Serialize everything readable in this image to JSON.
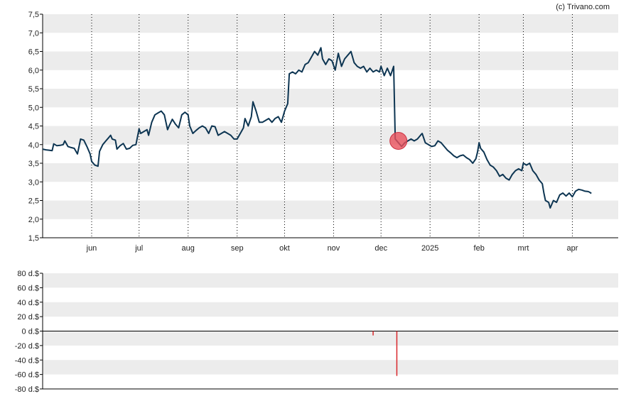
{
  "copyright": "(c) Trivano.com",
  "colors": {
    "line": "#0d3552",
    "band": "#ececec",
    "grid": "#000000",
    "marker": "#e8505b",
    "bar": "#d9262a"
  },
  "chart_data": [
    {
      "type": "line",
      "ylim": [
        1.5,
        7.5
      ],
      "yticks": [
        "7,5",
        "7,0",
        "6,5",
        "6,0",
        "5,5",
        "5,0",
        "4,5",
        "4,0",
        "3,5",
        "3,0",
        "2,5",
        "2,0",
        "1,5"
      ],
      "ytick_values": [
        7.5,
        7.0,
        6.5,
        6.0,
        5.5,
        5.0,
        4.5,
        4.0,
        3.5,
        3.0,
        2.5,
        2.0,
        1.5
      ],
      "xticks": [
        "jun",
        "jul",
        "aug",
        "sep",
        "okt",
        "nov",
        "dec",
        "2025",
        "feb",
        "mrt",
        "apr"
      ],
      "xtick_days": [
        31,
        61,
        92,
        123,
        153,
        184,
        214,
        245,
        276,
        304,
        335
      ],
      "xlim_days": [
        0,
        364
      ],
      "grid": "vertical dotted",
      "series": [
        {
          "values": [
            [
              0,
              3.88
            ],
            [
              2,
              3.86
            ],
            [
              4,
              3.85
            ],
            [
              6,
              3.84
            ],
            [
              7,
              4.02
            ],
            [
              9,
              3.97
            ],
            [
              11,
              3.98
            ],
            [
              13,
              4.0
            ],
            [
              14,
              4.1
            ],
            [
              16,
              3.95
            ],
            [
              18,
              3.92
            ],
            [
              20,
              3.9
            ],
            [
              22,
              3.75
            ],
            [
              24,
              4.15
            ],
            [
              26,
              4.12
            ],
            [
              28,
              3.95
            ],
            [
              30,
              3.75
            ],
            [
              31,
              3.55
            ],
            [
              33,
              3.45
            ],
            [
              35,
              3.42
            ],
            [
              36,
              3.82
            ],
            [
              38,
              4.0
            ],
            [
              40,
              4.1
            ],
            [
              42,
              4.2
            ],
            [
              43,
              4.25
            ],
            [
              44,
              4.15
            ],
            [
              46,
              4.12
            ],
            [
              47,
              3.88
            ],
            [
              49,
              3.97
            ],
            [
              51,
              4.03
            ],
            [
              53,
              3.88
            ],
            [
              55,
              3.9
            ],
            [
              57,
              3.98
            ],
            [
              59,
              4.0
            ],
            [
              61,
              4.42
            ],
            [
              62,
              4.3
            ],
            [
              64,
              4.35
            ],
            [
              66,
              4.4
            ],
            [
              67,
              4.25
            ],
            [
              69,
              4.6
            ],
            [
              71,
              4.8
            ],
            [
              73,
              4.85
            ],
            [
              75,
              4.9
            ],
            [
              77,
              4.8
            ],
            [
              79,
              4.4
            ],
            [
              80,
              4.5
            ],
            [
              82,
              4.68
            ],
            [
              84,
              4.55
            ],
            [
              86,
              4.45
            ],
            [
              88,
              4.8
            ],
            [
              90,
              4.87
            ],
            [
              92,
              4.8
            ],
            [
              93,
              4.5
            ],
            [
              95,
              4.3
            ],
            [
              97,
              4.38
            ],
            [
              99,
              4.45
            ],
            [
              101,
              4.5
            ],
            [
              103,
              4.45
            ],
            [
              105,
              4.3
            ],
            [
              107,
              4.5
            ],
            [
              109,
              4.48
            ],
            [
              111,
              4.25
            ],
            [
              113,
              4.3
            ],
            [
              115,
              4.35
            ],
            [
              117,
              4.3
            ],
            [
              119,
              4.25
            ],
            [
              121,
              4.15
            ],
            [
              123,
              4.15
            ],
            [
              125,
              4.3
            ],
            [
              127,
              4.45
            ],
            [
              128,
              4.7
            ],
            [
              130,
              4.5
            ],
            [
              132,
              4.75
            ],
            [
              133,
              5.15
            ],
            [
              135,
              4.9
            ],
            [
              137,
              4.6
            ],
            [
              139,
              4.6
            ],
            [
              141,
              4.65
            ],
            [
              143,
              4.7
            ],
            [
              145,
              4.6
            ],
            [
              147,
              4.7
            ],
            [
              149,
              4.75
            ],
            [
              151,
              4.6
            ],
            [
              153,
              4.9
            ],
            [
              155,
              5.1
            ],
            [
              156,
              5.9
            ],
            [
              158,
              5.95
            ],
            [
              160,
              5.9
            ],
            [
              162,
              6.0
            ],
            [
              164,
              5.95
            ],
            [
              166,
              6.15
            ],
            [
              168,
              6.2
            ],
            [
              170,
              6.35
            ],
            [
              172,
              6.5
            ],
            [
              174,
              6.4
            ],
            [
              176,
              6.6
            ],
            [
              177,
              6.3
            ],
            [
              179,
              6.15
            ],
            [
              181,
              6.3
            ],
            [
              183,
              6.25
            ],
            [
              185,
              6.0
            ],
            [
              187,
              6.45
            ],
            [
              189,
              6.1
            ],
            [
              191,
              6.3
            ],
            [
              193,
              6.4
            ],
            [
              195,
              6.5
            ],
            [
              197,
              6.2
            ],
            [
              199,
              6.1
            ],
            [
              201,
              6.05
            ],
            [
              203,
              6.1
            ],
            [
              205,
              5.95
            ],
            [
              207,
              6.05
            ],
            [
              209,
              5.95
            ],
            [
              211,
              6.0
            ],
            [
              213,
              5.95
            ],
            [
              214,
              6.1
            ],
            [
              216,
              5.85
            ],
            [
              218,
              6.05
            ],
            [
              220,
              5.85
            ],
            [
              222,
              6.1
            ],
            [
              223,
              4.15
            ],
            [
              225,
              4.05
            ],
            [
              227,
              3.95
            ],
            [
              229,
              4.05
            ],
            [
              231,
              4.1
            ],
            [
              233,
              4.15
            ],
            [
              235,
              4.1
            ],
            [
              237,
              4.15
            ],
            [
              239,
              4.25
            ],
            [
              240,
              4.3
            ],
            [
              242,
              4.05
            ],
            [
              244,
              4.0
            ],
            [
              246,
              3.95
            ],
            [
              248,
              3.97
            ],
            [
              250,
              4.1
            ],
            [
              252,
              4.05
            ],
            [
              254,
              3.95
            ],
            [
              256,
              3.85
            ],
            [
              258,
              3.78
            ],
            [
              260,
              3.7
            ],
            [
              262,
              3.65
            ],
            [
              264,
              3.7
            ],
            [
              266,
              3.72
            ],
            [
              268,
              3.65
            ],
            [
              270,
              3.6
            ],
            [
              272,
              3.5
            ],
            [
              274,
              3.62
            ],
            [
              275,
              3.8
            ],
            [
              276,
              4.05
            ],
            [
              277,
              3.9
            ],
            [
              279,
              3.8
            ],
            [
              281,
              3.6
            ],
            [
              283,
              3.45
            ],
            [
              285,
              3.4
            ],
            [
              287,
              3.3
            ],
            [
              289,
              3.15
            ],
            [
              291,
              3.2
            ],
            [
              293,
              3.1
            ],
            [
              295,
              3.05
            ],
            [
              297,
              3.2
            ],
            [
              299,
              3.3
            ],
            [
              301,
              3.35
            ],
            [
              303,
              3.3
            ],
            [
              304,
              3.5
            ],
            [
              306,
              3.45
            ],
            [
              308,
              3.5
            ],
            [
              310,
              3.3
            ],
            [
              312,
              3.2
            ],
            [
              314,
              3.05
            ],
            [
              316,
              2.95
            ],
            [
              317,
              2.7
            ],
            [
              318,
              2.5
            ],
            [
              320,
              2.45
            ],
            [
              321,
              2.3
            ],
            [
              323,
              2.5
            ],
            [
              325,
              2.45
            ],
            [
              327,
              2.65
            ],
            [
              329,
              2.7
            ],
            [
              331,
              2.62
            ],
            [
              333,
              2.7
            ],
            [
              335,
              2.6
            ],
            [
              337,
              2.75
            ],
            [
              339,
              2.8
            ],
            [
              341,
              2.78
            ],
            [
              343,
              2.75
            ],
            [
              345,
              2.74
            ],
            [
              346,
              2.72
            ],
            [
              347,
              2.69
            ]
          ]
        }
      ],
      "marker": {
        "day": 225,
        "value": 4.1
      }
    },
    {
      "type": "bar",
      "ylim": [
        -80,
        80
      ],
      "yticks": [
        "80 d.$",
        "60 d.$",
        "40 d.$",
        "20 d.$",
        "0 d.$",
        "-20 d.$",
        "-40 d.$",
        "-60 d.$",
        "-80 d.$"
      ],
      "ytick_values": [
        80,
        60,
        40,
        20,
        0,
        -20,
        -40,
        -60,
        -80
      ],
      "xlim_days": [
        0,
        364
      ],
      "series": [
        {
          "values": [
            [
              209,
              -6
            ],
            [
              224,
              -62
            ]
          ]
        }
      ]
    }
  ]
}
